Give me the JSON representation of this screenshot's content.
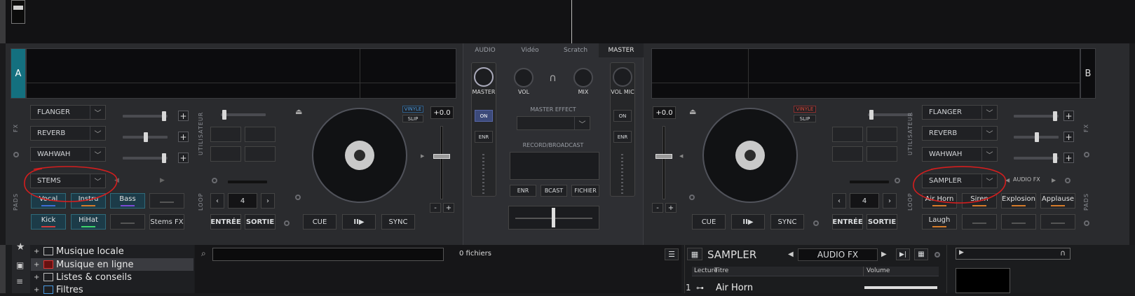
{
  "deck_a": {
    "letter": "A",
    "fx": [
      "FLANGER",
      "REVERB",
      "WAHWAH"
    ],
    "fx_label": "FX",
    "user_label": "UTILISATEUR",
    "pads_label": "PADS",
    "loop_label": "LOOP",
    "pad_mode": "STEMS",
    "pads": [
      "Vocal",
      "Instru",
      "Bass",
      "Kick",
      "HiHat"
    ],
    "stems_fx": "Stems FX",
    "loop_value": "4",
    "loop_in": "ENTRÉE",
    "loop_out": "SORTIE",
    "vinyl": "VINYLE",
    "slip": "SLIP",
    "pitch": "+0.0",
    "cue": "CUE",
    "play": "II▶",
    "sync": "SYNC",
    "minus": "-",
    "plus": "+"
  },
  "deck_b": {
    "letter": "B",
    "fx": [
      "FLANGER",
      "REVERB",
      "WAHWAH"
    ],
    "fx_label": "FX",
    "user_label": "UTILISATEUR",
    "pads_label": "PADS",
    "loop_label": "LOOP",
    "pad_mode": "SAMPLER",
    "audio_fx": "AUDIO FX",
    "pads": [
      "Air Horn",
      "Siren",
      "Explosion",
      "Applause",
      "Laugh"
    ],
    "loop_value": "4",
    "loop_in": "ENTRÉE",
    "loop_out": "SORTIE",
    "vinyl": "VINYLE",
    "slip": "SLIP",
    "pitch": "+0.0",
    "cue": "CUE",
    "play": "II▶",
    "sync": "SYNC",
    "minus": "-",
    "plus": "+"
  },
  "mixer": {
    "tabs": [
      "AUDIO",
      "Vidéo",
      "Scratch",
      "MASTER"
    ],
    "knobs": [
      "MASTER",
      "VOL",
      "MIX",
      "VOL MIC"
    ],
    "on": "ON",
    "enr": "ENR",
    "master_effect": "MASTER EFFECT",
    "record_broadcast": "RECORD/BROADCAST",
    "rec_buttons": [
      "ENR",
      "BCAST",
      "FICHIER"
    ]
  },
  "browser": {
    "tree": [
      "Musique locale",
      "Musique en ligne",
      "Listes & conseils",
      "Filtres"
    ],
    "file_count": "0 fichiers",
    "sampler_title": "SAMPLER",
    "sampler_bank": "AUDIO FX",
    "columns": [
      "Lecture",
      "Titre",
      "Volume"
    ],
    "row1_num": "1",
    "row1_title": "Air Horn"
  },
  "colors": {
    "accent": "#14707f",
    "annotation": "#d41e1e",
    "vinyl_red": "#c0392b",
    "vinyl_blue": "#2f7fd6"
  }
}
